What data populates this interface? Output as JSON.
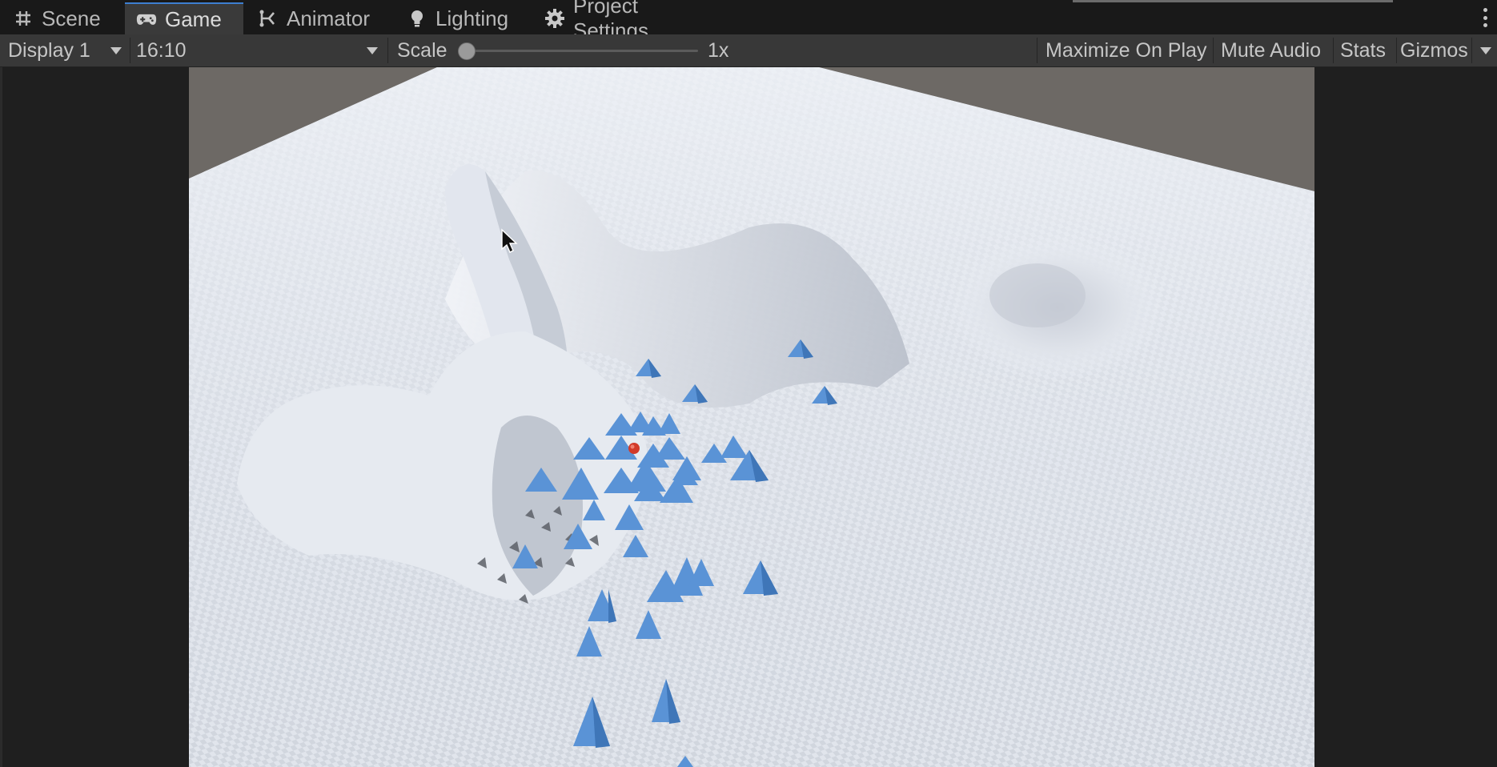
{
  "tabs": [
    {
      "label": "Scene",
      "icon": "grid-icon",
      "active": false
    },
    {
      "label": "Game",
      "icon": "gamepad-icon",
      "active": true
    },
    {
      "label": "Animator",
      "icon": "animator-icon",
      "active": false
    },
    {
      "label": "Lighting",
      "icon": "lightbulb-icon",
      "active": false
    },
    {
      "label": "Project Settings",
      "icon": "gear-icon",
      "active": false
    }
  ],
  "toolbar": {
    "display": "Display 1",
    "aspect": "16:10",
    "scale_label": "Scale",
    "scale_value": "1x",
    "scale_fraction": 0.0,
    "maximize": "Maximize On Play",
    "mute": "Mute Audio",
    "stats": "Stats",
    "gizmos": "Gizmos"
  },
  "colors": {
    "accent": "#3d7fd1",
    "sky": "#6d6965",
    "terrain": "#dfe4ec",
    "pyramid": "#4f86c6",
    "ball": "#d23a2a"
  }
}
